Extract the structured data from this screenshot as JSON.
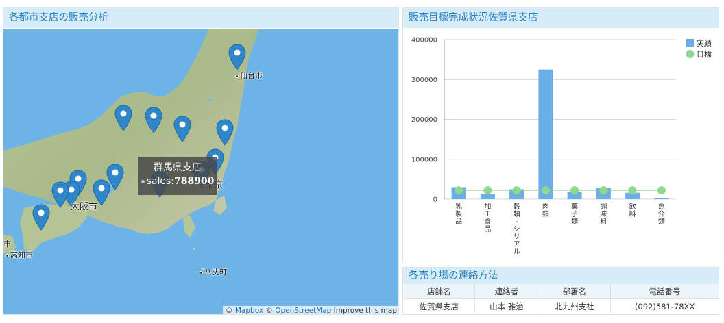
{
  "map_panel": {
    "title": "各都市支店の販売分析",
    "cities": {
      "sendai": "仙台市",
      "tokyo": "東京",
      "osaka": "大阪市",
      "kochi": "高知市",
      "hachijo": "八丈町",
      "edge": "市"
    },
    "tooltip": {
      "name": "群馬県支店",
      "metric_label": "sales:",
      "metric_value": "788900"
    },
    "attribution": {
      "copy1": "©",
      "mapbox": "Mapbox",
      "copy2": "©",
      "osm": "OpenStreetMap",
      "improve": "Improve this map"
    }
  },
  "chart_panel": {
    "title": "販売目標完成状況佐賀県支店",
    "chart_data": {
      "type": "bar",
      "categories": [
        "乳製品",
        "加工食品",
        "穀類・シリアル",
        "肉類",
        "菓子類",
        "調味料",
        "飲料",
        "魚介類"
      ],
      "series": [
        {
          "name": "実績",
          "type": "bar",
          "color": "#6aaee8",
          "values": [
            30000,
            12000,
            25000,
            325000,
            18000,
            28000,
            16000,
            2000
          ]
        },
        {
          "name": "目標",
          "type": "line",
          "color": "#8ed88e",
          "values": [
            22000,
            22000,
            22000,
            22000,
            22000,
            22000,
            22000,
            22000
          ]
        }
      ],
      "ylim": [
        0,
        400000
      ],
      "yticks": [
        "0",
        "100000",
        "200000",
        "300000",
        "400000"
      ],
      "grid": true,
      "legend": "top-right"
    }
  },
  "contact_panel": {
    "title": "各売り場の連絡方法",
    "headers": [
      "店舗名",
      "連絡者",
      "部署名",
      "電話番号"
    ],
    "rows": [
      [
        "佐賀県支店",
        "山本 雅治",
        "北九州支社",
        "(092)581-78XX"
      ]
    ]
  }
}
